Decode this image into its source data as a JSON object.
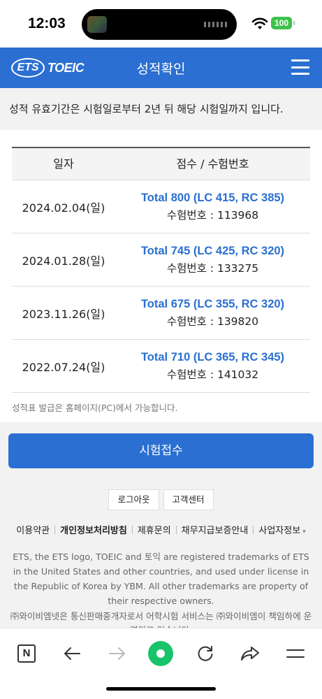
{
  "status_bar": {
    "time": "12:03",
    "battery": "100"
  },
  "header": {
    "logo_ets": "ETS",
    "logo_toeic": "TOEIC",
    "title": "성적확인"
  },
  "notice": "성적 유효기간은 시험일로부터 2년 뒤 해당 시험일까지 입니다.",
  "table": {
    "headers": [
      "일자",
      "점수 / 수험번호"
    ],
    "rows": [
      {
        "date": "2024.02.04(일)",
        "score": "Total 800 (LC 415, RC 385)",
        "exam_no": "수험번호 : 113968"
      },
      {
        "date": "2024.01.28(일)",
        "score": "Total 745 (LC 425, RC 320)",
        "exam_no": "수험번호 : 133275"
      },
      {
        "date": "2023.11.26(일)",
        "score": "Total 675 (LC 355, RC 320)",
        "exam_no": "수험번호 : 139820"
      },
      {
        "date": "2022.07.24(일)",
        "score": "Total 710 (LC 365, RC 345)",
        "exam_no": "수험번호 : 141032"
      }
    ],
    "note": "성적표 발급은 홈페이지(PC)에서 가능합니다."
  },
  "apply_button": "시험접수",
  "small_buttons": {
    "logout": "로그아웃",
    "support": "고객센터"
  },
  "footer_links": [
    "이용약관",
    "개인정보처리방침",
    "제휴문의",
    "채무지급보증안내",
    "사업자정보"
  ],
  "legal": "ETS, the ETS logo, TOEIC and 토익 are registered trademarks of ETS in the United States and other countries, and used under license in the Republic of Korea by YBM. All other trademarks are property of their respective owners.",
  "company": "㈜와이비엠넷은 통신판매중개자로서 어학시험 서비스는 ㈜와이비엠이 책임하에 운영되고 있습니다.",
  "colors": {
    "brand_blue": "#2a6fd1",
    "battery_green": "#3ec14a",
    "browser_green": "#19c36a"
  },
  "toolbar_icons": [
    "n-tab-icon",
    "back-arrow-icon",
    "forward-arrow-icon",
    "green-dot-icon",
    "refresh-icon",
    "share-icon",
    "menu-lines-icon"
  ]
}
